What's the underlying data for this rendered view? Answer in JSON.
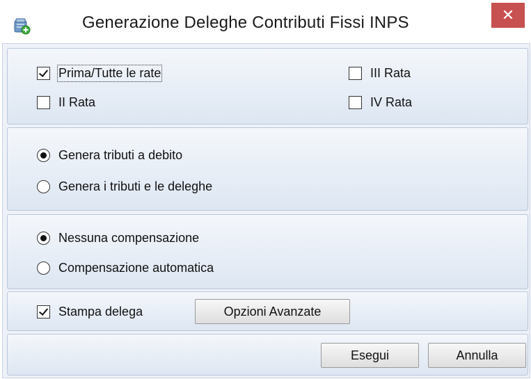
{
  "window": {
    "title": "Generazione Deleghe Contributi Fissi INPS",
    "close_label": "✕"
  },
  "rate": {
    "prima": {
      "label": "Prima/Tutte le rate",
      "checked": true
    },
    "terza": {
      "label": "III Rata",
      "checked": false
    },
    "seconda": {
      "label": "II Rata",
      "checked": false
    },
    "quarta": {
      "label": "IV Rata",
      "checked": false
    }
  },
  "generazione": {
    "debito": {
      "label": "Genera tributi a debito",
      "selected": true
    },
    "deleghe": {
      "label": "Genera i tributi e le deleghe",
      "selected": false
    }
  },
  "compensazione": {
    "nessuna": {
      "label": "Nessuna compensazione",
      "selected": true
    },
    "automatica": {
      "label": "Compensazione automatica",
      "selected": false
    }
  },
  "stampa": {
    "label": "Stampa delega",
    "checked": true,
    "opzioni_label": "Opzioni Avanzate"
  },
  "actions": {
    "esegui_label": "Esegui",
    "annulla_label": "Annulla"
  },
  "colors": {
    "close_button": "#c75050",
    "panel_top": "#f4f7fb",
    "panel_bottom": "#dde6f2",
    "panel_border": "#b9c6da"
  }
}
